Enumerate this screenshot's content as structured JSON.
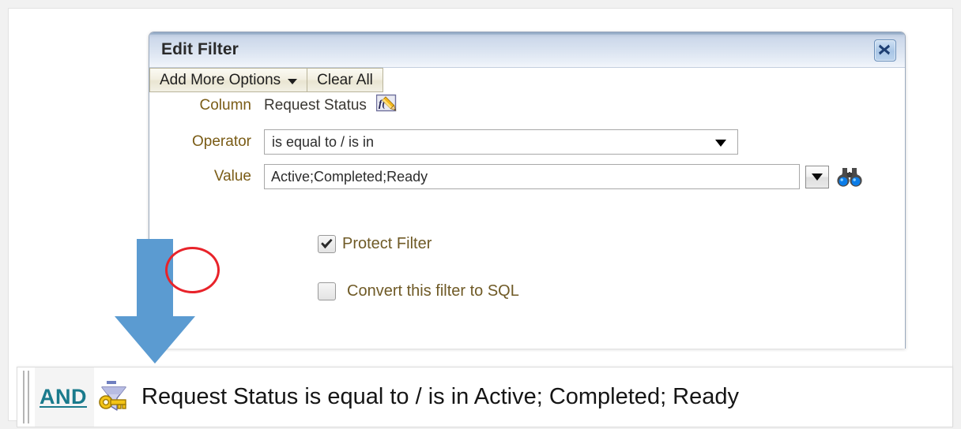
{
  "dialog": {
    "title": "Edit Filter",
    "close_icon": "close-x-icon",
    "fields": {
      "column": {
        "label": "Column",
        "value": "Request Status",
        "formula_icon": "fx-edit-icon"
      },
      "operator": {
        "label": "Operator",
        "value": "is equal to / is in",
        "dropdown_icon": "chevron-down-icon"
      },
      "value": {
        "label": "Value",
        "value": "Active;Completed;Ready",
        "placeholder": "",
        "dropdown_icon": "dropdown-triangle-icon",
        "search_icon": "binoculars-icon"
      }
    },
    "buttons": {
      "add_more_options": "Add More Options",
      "clear_all": "Clear All"
    },
    "checkboxes": [
      {
        "label": "Protect Filter",
        "checked": true
      },
      {
        "label": "Convert this filter to SQL",
        "checked": false
      }
    ]
  },
  "annotations": {
    "ellipse_color": "#e8232a",
    "arrow_color": "#5b9bd1",
    "arrow_icon": "down-arrow-annotation"
  },
  "result_bar": {
    "drag_handle_icon": "drag-handle-icon",
    "operator_link": "AND",
    "filter_icon": "filter-key-icon",
    "expression": "Request Status is equal to / is in  Active; Completed; Ready"
  },
  "colors": {
    "label_text": "#7a5c16",
    "link_teal": "#1a7a8c",
    "titlebar_blue": "#ccd8ea",
    "arrow_blue": "#5b9bd1",
    "annotation_red": "#e8232a"
  }
}
